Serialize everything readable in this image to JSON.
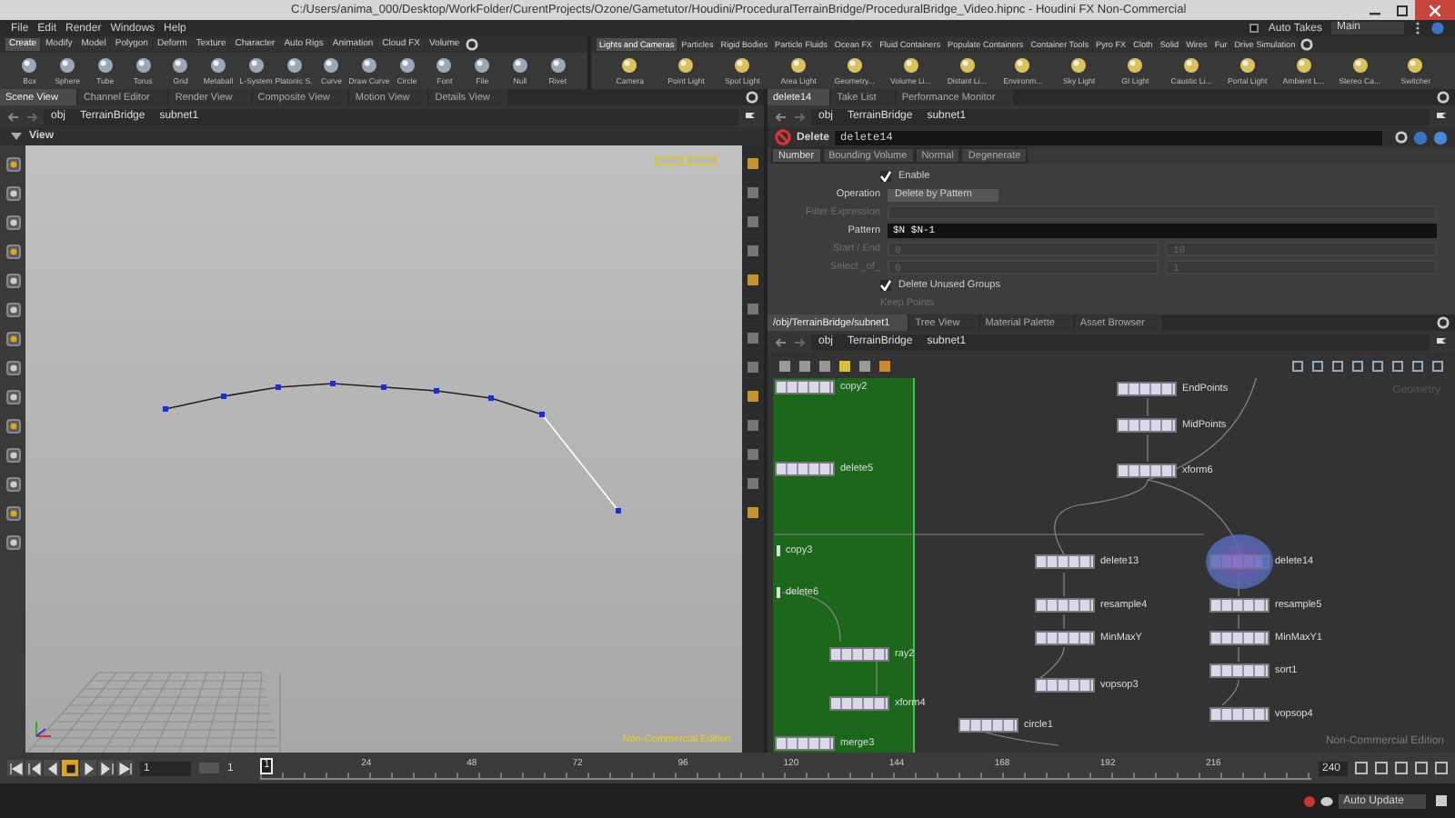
{
  "window": {
    "title": "C:/Users/anima_000/Desktop/WorkFolder/CurentProjects/Ozone/Gametutor/Houdini/ProceduralTerrainBridge/ProceduralBridge_Video.hipnc - Houdini FX Non-Commercial"
  },
  "menu": [
    "File",
    "Edit",
    "Render",
    "Windows",
    "Help"
  ],
  "auto_takes": {
    "label": "Auto Takes",
    "checked": false
  },
  "take": "Main",
  "shelf_left": {
    "tabs": [
      {
        "label": "Create",
        "selected": true
      },
      {
        "label": "Modify",
        "selected": false
      },
      {
        "label": "Model",
        "selected": false
      },
      {
        "label": "Polygon",
        "selected": false
      },
      {
        "label": "Deform",
        "selected": false
      },
      {
        "label": "Texture",
        "selected": false
      },
      {
        "label": "Character",
        "selected": false
      },
      {
        "label": "Auto Rigs",
        "selected": false
      },
      {
        "label": "Animation",
        "selected": false
      },
      {
        "label": "Cloud FX",
        "selected": false
      },
      {
        "label": "Volume",
        "selected": false
      }
    ],
    "tools": [
      "Box",
      "Sphere",
      "Tube",
      "Torus",
      "Grid",
      "Metaball",
      "L-System",
      "Platonic S.",
      "Curve",
      "Draw Curve",
      "Circle",
      "Font",
      "File",
      "Null",
      "Rivet"
    ]
  },
  "shelf_right": {
    "tabs": [
      {
        "label": "Lights and Cameras",
        "selected": true
      },
      {
        "label": "Particles",
        "selected": false
      },
      {
        "label": "Rigid Bodies",
        "selected": false
      },
      {
        "label": "Particle Fluids",
        "selected": false
      },
      {
        "label": "Ocean FX",
        "selected": false
      },
      {
        "label": "Fluid Containers",
        "selected": false
      },
      {
        "label": "Populate Containers",
        "selected": false
      },
      {
        "label": "Container Tools",
        "selected": false
      },
      {
        "label": "Pyro FX",
        "selected": false
      },
      {
        "label": "Cloth",
        "selected": false
      },
      {
        "label": "Solid",
        "selected": false
      },
      {
        "label": "Wires",
        "selected": false
      },
      {
        "label": "Fur",
        "selected": false
      },
      {
        "label": "Drive Simulation",
        "selected": false
      }
    ],
    "tools": [
      "Camera",
      "Point Light",
      "Spot Light",
      "Area Light",
      "Geometry...",
      "Volume Li...",
      "Distant Li...",
      "Environm...",
      "Sky Light",
      "GI Light",
      "Caustic Li...",
      "Portal Light",
      "Ambient L...",
      "Stereo Ca...",
      "Switcher"
    ]
  },
  "scene_pane": {
    "tabs": [
      {
        "label": "Scene View",
        "selected": true
      },
      {
        "label": "Channel Editor",
        "selected": false
      },
      {
        "label": "Render View",
        "selected": false
      },
      {
        "label": "Composite View",
        "selected": false
      },
      {
        "label": "Motion View",
        "selected": false
      },
      {
        "label": "Details View",
        "selected": false
      }
    ],
    "path": [
      "obj",
      "TerrainBridge",
      "subnet1"
    ],
    "view_title": "View",
    "edition_label": "Non-Commercial Edition"
  },
  "param_pane": {
    "tabs": [
      {
        "label": "delete14",
        "selected": true
      },
      {
        "label": "Take List",
        "selected": false
      },
      {
        "label": "Performance Monitor",
        "selected": false
      }
    ],
    "path": [
      "obj",
      "TerrainBridge",
      "subnet1"
    ],
    "node_type": "Delete",
    "node_name": "delete14",
    "param_tabs": [
      {
        "label": "Number",
        "selected": true
      },
      {
        "label": "Bounding Volume",
        "selected": false
      },
      {
        "label": "Normal",
        "selected": false
      },
      {
        "label": "Degenerate",
        "selected": false
      }
    ],
    "params": [
      {
        "kind": "checkbox",
        "label": "Enable",
        "checked": true
      },
      {
        "kind": "menu",
        "label": "Operation",
        "value": "Delete by Pattern"
      },
      {
        "kind": "field",
        "label": "Filter Expression",
        "disabled": true
      },
      {
        "kind": "field",
        "label": "Pattern",
        "value": "$N $N-1",
        "disabled": false
      },
      {
        "kind": "pair",
        "label": "Start / End",
        "values": [
          "0",
          "10"
        ],
        "disabled": true
      },
      {
        "kind": "pair",
        "label": "Select _of_",
        "values": [
          "0",
          "1"
        ],
        "disabled": true
      },
      {
        "kind": "checkbox",
        "label": "Delete Unused Groups",
        "checked": true
      },
      {
        "kind": "label",
        "label": "Keep Points",
        "disabled": true
      }
    ]
  },
  "network_pane": {
    "tabs": [
      {
        "label": "/obj/TerrainBridge/subnet1",
        "selected": true
      },
      {
        "label": "Tree View",
        "selected": false
      },
      {
        "label": "Material Palette",
        "selected": false
      },
      {
        "label": "Asset Browser",
        "selected": false
      }
    ],
    "path": [
      "obj",
      "TerrainBridge",
      "subnet1"
    ],
    "context_label": "Geometry",
    "edition_label": "Non-Commercial Edition",
    "nodes": [
      {
        "kind": "node",
        "name": "copy2",
        "selected": false
      },
      {
        "kind": "node",
        "name": "delete5",
        "selected": false
      },
      {
        "kind": "label",
        "name": "copy3",
        "selected": false
      },
      {
        "kind": "label",
        "name": "delete6",
        "selected": false
      },
      {
        "kind": "node",
        "name": "ray2",
        "selected": false
      },
      {
        "kind": "node",
        "name": "xform4",
        "selected": false
      },
      {
        "kind": "node",
        "name": "merge3",
        "selected": false
      },
      {
        "kind": "node",
        "name": "EndPoints",
        "selected": false
      },
      {
        "kind": "node",
        "name": "MidPoints",
        "selected": false
      },
      {
        "kind": "node",
        "name": "xform6",
        "selected": false
      },
      {
        "kind": "node",
        "name": "delete13",
        "selected": false
      },
      {
        "kind": "node",
        "name": "resample4",
        "selected": false
      },
      {
        "kind": "node",
        "name": "MinMaxY",
        "selected": false
      },
      {
        "kind": "node",
        "name": "vopsop3",
        "selected": false
      },
      {
        "kind": "node",
        "name": "circle1",
        "selected": false
      },
      {
        "kind": "node",
        "name": "delete14",
        "selected": true
      },
      {
        "kind": "node",
        "name": "resample5",
        "selected": false
      },
      {
        "kind": "node",
        "name": "MinMaxY1",
        "selected": false
      },
      {
        "kind": "node",
        "name": "sort1",
        "selected": false
      },
      {
        "kind": "node",
        "name": "vopsop4",
        "selected": false
      }
    ]
  },
  "timeline": {
    "playback_buttons": [
      {
        "kind": "skip_start",
        "selected": false
      },
      {
        "kind": "step_back",
        "selected": false
      },
      {
        "kind": "play_reverse",
        "selected": false
      },
      {
        "kind": "stop",
        "selected": true
      },
      {
        "kind": "play",
        "selected": false
      },
      {
        "kind": "step_forward",
        "selected": false
      },
      {
        "kind": "skip_end",
        "selected": false
      }
    ],
    "current_frame": "1",
    "start_frame": "1",
    "ruler_start": "1",
    "ticks": [
      "24",
      "48",
      "72",
      "96",
      "120",
      "144",
      "168",
      "192",
      "216"
    ],
    "end_frame": "240"
  },
  "status_bar": {
    "update_mode": "Auto Update"
  }
}
